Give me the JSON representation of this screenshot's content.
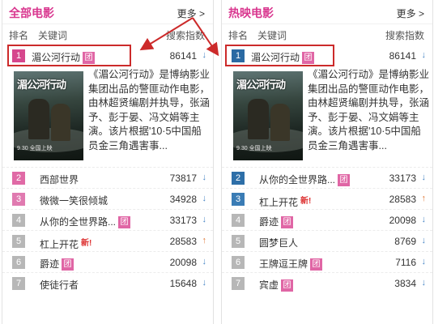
{
  "colors": {
    "title": "#d9378f",
    "tuan": "#e066a5",
    "highlight": "#cc2a2a",
    "down": "#4a86c5",
    "up": "#e07a3a"
  },
  "left": {
    "title": "全部电影",
    "more": "更多 >",
    "columns": {
      "rank": "排名",
      "keyword": "关键词",
      "index": "搜索指数"
    },
    "featured": {
      "rank": "1",
      "name": "湄公河行动",
      "tag": "团",
      "value": "86141",
      "trend": "↓",
      "poster_title": "湄公河行动",
      "poster_sub": "9.30 全国上映",
      "description": "《湄公河行动》是博纳影业集团出品的警匪动作电影，由林超贤编剧并执导，张涵予、彭于晏、冯文娟等主演。该片根据'10·5中国船员金三角遇害事..."
    },
    "rows": [
      {
        "rank": "2",
        "name": "西部世界",
        "tag": "",
        "new": "",
        "value": "73817",
        "trend": "↓",
        "color": "#e06aa6"
      },
      {
        "rank": "3",
        "name": "微微一笑很倾城",
        "tag": "",
        "new": "",
        "value": "34928",
        "trend": "↓",
        "color": "#e07ab0"
      },
      {
        "rank": "4",
        "name": "从你的全世界路...",
        "tag": "团",
        "new": "",
        "value": "33173",
        "trend": "↓",
        "color": "#b7b7b7"
      },
      {
        "rank": "5",
        "name": "杠上开花",
        "tag": "",
        "new": "新!",
        "value": "28583",
        "trend": "↑",
        "color": "#b7b7b7"
      },
      {
        "rank": "6",
        "name": "爵迹",
        "tag": "团",
        "new": "",
        "value": "20098",
        "trend": "↓",
        "color": "#b7b7b7"
      },
      {
        "rank": "7",
        "name": "使徒行者",
        "tag": "",
        "new": "",
        "value": "15648",
        "trend": "↓",
        "color": "#b7b7b7"
      }
    ]
  },
  "right": {
    "title": "热映电影",
    "more": "更多 >",
    "columns": {
      "rank": "排名",
      "keyword": "关键词",
      "index": "搜索指数"
    },
    "featured": {
      "rank": "1",
      "name": "湄公河行动",
      "tag": "团",
      "value": "86141",
      "trend": "↓",
      "poster_title": "湄公河行动",
      "poster_sub": "9.30 全国上映",
      "description": "《湄公河行动》是博纳影业集团出品的警匪动作电影，由林超贤编剧并执导，张涵予、彭于晏、冯文娟等主演。该片根据'10·5中国船员金三角遇害事..."
    },
    "rows": [
      {
        "rank": "2",
        "name": "从你的全世界路...",
        "tag": "团",
        "new": "",
        "value": "33173",
        "trend": "↓",
        "color": "#2e6fa8"
      },
      {
        "rank": "3",
        "name": "杠上开花",
        "tag": "",
        "new": "新!",
        "value": "28583",
        "trend": "↑",
        "color": "#3a7cb5"
      },
      {
        "rank": "4",
        "name": "爵迹",
        "tag": "团",
        "new": "",
        "value": "20098",
        "trend": "↓",
        "color": "#b7b7b7"
      },
      {
        "rank": "5",
        "name": "圆梦巨人",
        "tag": "",
        "new": "",
        "value": "8769",
        "trend": "↓",
        "color": "#b7b7b7"
      },
      {
        "rank": "6",
        "name": "王牌逗王牌",
        "tag": "团",
        "new": "",
        "value": "7116",
        "trend": "↓",
        "color": "#b7b7b7"
      },
      {
        "rank": "7",
        "name": "宾虚",
        "tag": "团",
        "new": "",
        "value": "3834",
        "trend": "↓",
        "color": "#b7b7b7"
      }
    ]
  }
}
